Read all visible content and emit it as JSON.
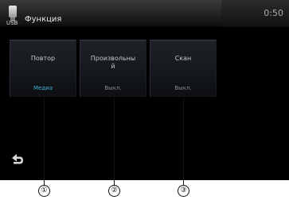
{
  "header": {
    "usb_label": "USB",
    "title": "Функция",
    "clock": "0:50"
  },
  "tiles": [
    {
      "label": "Повтор",
      "value": "Медиа",
      "value_color": "#3fb6d8"
    },
    {
      "label": "Произвольны\nй",
      "value": "Выкл.",
      "value_color": "#8a8a8a"
    },
    {
      "label": "Скан",
      "value": "Выкл.",
      "value_color": "#8a8a8a"
    }
  ],
  "callouts": [
    "①",
    "②",
    "③"
  ],
  "icons": {
    "back": "back-arrow-icon",
    "usb": "usb-icon"
  }
}
